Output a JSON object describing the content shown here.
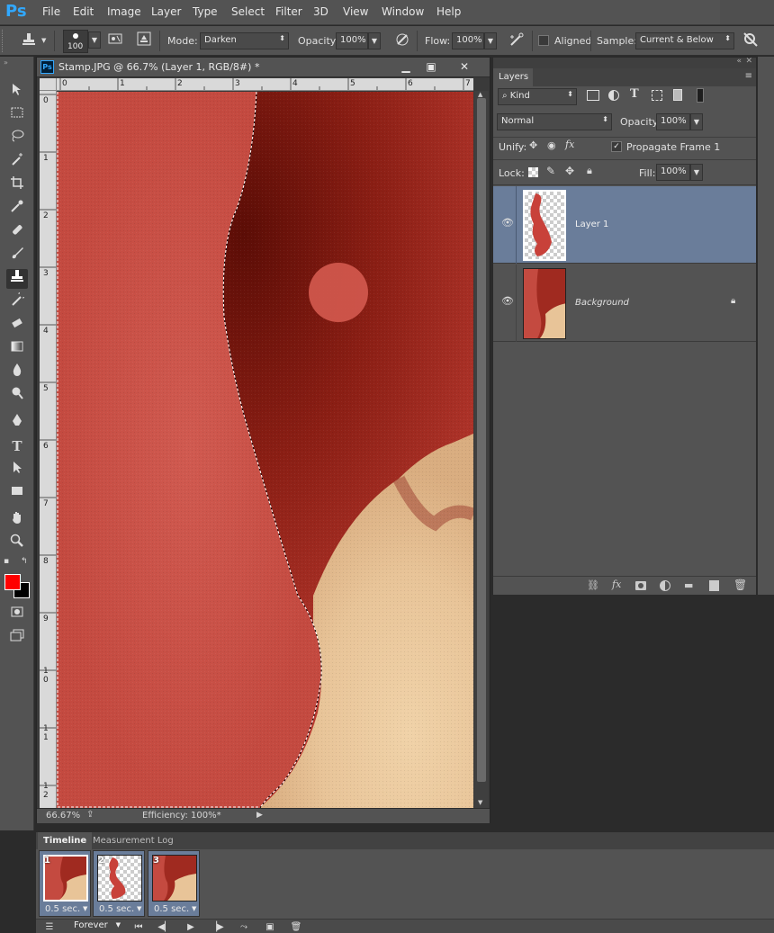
{
  "app": {
    "logo": "Ps"
  },
  "menu": [
    "File",
    "Edit",
    "Image",
    "Layer",
    "Type",
    "Select",
    "Filter",
    "3D",
    "View",
    "Window",
    "Help"
  ],
  "options": {
    "brush_size": "100",
    "mode_label": "Mode:",
    "mode_value": "Darken",
    "opacity_label": "Opacity:",
    "opacity_value": "100%",
    "flow_label": "Flow:",
    "flow_value": "100%",
    "aligned_label": "Aligned",
    "sample_label": "Sample:",
    "sample_value": "Current & Below"
  },
  "document": {
    "title": "Stamp.JPG @ 66.7% (Layer 1, RGB/8#) *",
    "zoom": "66.67%",
    "efficiency": "Efficiency: 100%*",
    "ruler_top": [
      "0",
      "1",
      "2",
      "3",
      "4",
      "5",
      "6",
      "7"
    ],
    "ruler_left": [
      "0",
      "1",
      "2",
      "3",
      "4",
      "5",
      "6",
      "7",
      "8",
      "9",
      "1\n0",
      "1\n1",
      "1\n2"
    ]
  },
  "layers_panel": {
    "tab": "Layers",
    "kind": "Kind",
    "blend_mode": "Normal",
    "opacity_label": "Opacity:",
    "opacity_value": "100%",
    "unify_label": "Unify:",
    "propagate_label": "Propagate Frame 1",
    "lock_label": "Lock:",
    "fill_label": "Fill:",
    "fill_value": "100%",
    "layers": [
      {
        "name": "Layer 1",
        "selected": true
      },
      {
        "name": "Background",
        "selected": false,
        "locked": true
      }
    ]
  },
  "timeline": {
    "tabs": [
      "Timeline",
      "Measurement Log"
    ],
    "frames": [
      {
        "num": "1",
        "delay": "0.5 sec."
      },
      {
        "num": "2",
        "delay": "0.5 sec."
      },
      {
        "num": "3",
        "delay": "0.5 sec."
      }
    ],
    "loop": "Forever"
  },
  "colors": {
    "foreground": "#ff0000",
    "background": "#000000",
    "selection_highlight": "#6a7d9a"
  }
}
